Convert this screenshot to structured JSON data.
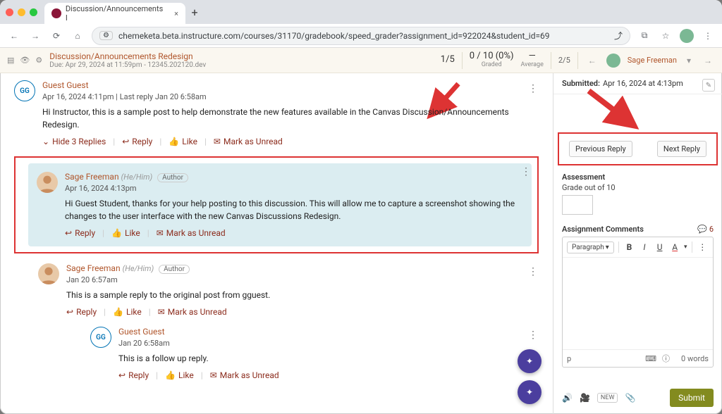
{
  "chrome": {
    "tab_title": "Discussion/Announcements I",
    "url": "chemeketa.beta.instructure.com/courses/31170/gradebook/speed_grader?assignment_id=922024&student_id=69"
  },
  "header": {
    "title": "Discussion/Announcements Redesign",
    "due": "Due: Apr 29, 2024 at 11:59pm - 12345.202120.dev",
    "metrics": {
      "pos": "1/5",
      "pos_lbl": "",
      "graded": "0 / 10 (0%)",
      "graded_lbl": "Graded",
      "avg": "—",
      "avg_lbl": "Average",
      "page": "2/5"
    },
    "student": "Sage Freeman"
  },
  "thread": {
    "op": {
      "avatar": "GG",
      "name": "Guest Guest",
      "time": "Apr 16, 2024 4:11pm  |  Last reply Jan 20 6:58am",
      "content": "Hi Instructor, this is a sample post to help demonstrate the new features available in the Canvas Discussion/Announcements Redesign.",
      "hide": "Hide 3 Replies"
    },
    "r1": {
      "name": "Sage Freeman",
      "pron": "(He/Him)",
      "pill": "Author",
      "time": "Apr 16, 2024 4:13pm",
      "content": "Hi Guest Student, thanks for your help posting to this discussion. This will allow me to capture a screenshot showing the changes to the user interface with the new Canvas Discussions Redesign."
    },
    "r2": {
      "name": "Sage Freeman",
      "pron": "(He/Him)",
      "pill": "Author",
      "time": "Jan 20 6:57am",
      "content": "This is a sample reply to the original post from gguest."
    },
    "r3": {
      "avatar": "GG",
      "name": "Guest Guest",
      "time": "Jan 20 6:58am",
      "content": "This is a follow up reply."
    },
    "actions": {
      "reply": "Reply",
      "like": "Like",
      "unread": "Mark as Unread"
    }
  },
  "grade": {
    "submitted_lbl": "Submitted:",
    "submitted_at": "Apr 16, 2024 at 4:13pm",
    "prev": "Previous Reply",
    "next": "Next Reply",
    "assessment": "Assessment",
    "outof": "Grade out of 10",
    "comments_h": "Assignment Comments",
    "comments_n": "6",
    "paragraph": "Paragraph",
    "path": "p",
    "words": "0 words",
    "new": "NEW",
    "submit": "Submit"
  }
}
